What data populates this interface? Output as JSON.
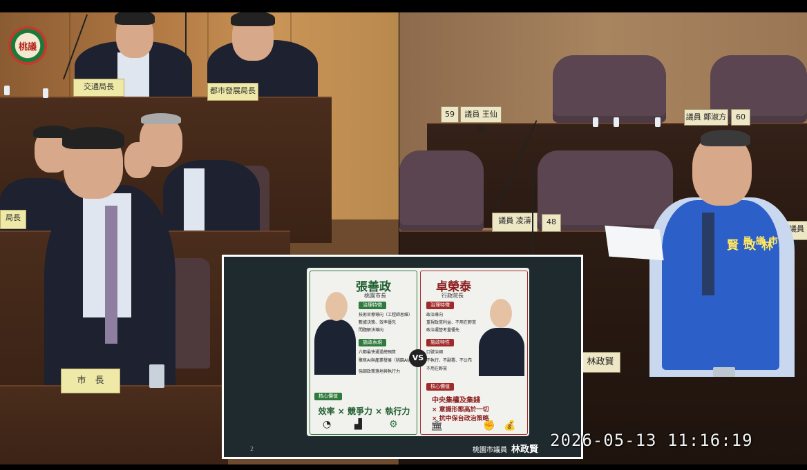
{
  "logo": {
    "text": "桃議"
  },
  "left_feed": {
    "nameplates": {
      "top_left": "交通局長",
      "top_right": "都市發展局長",
      "side": "局長",
      "mayor": "市　長"
    }
  },
  "right_feed": {
    "nameplates": {
      "seat_59_no": "59",
      "seat_59_name": "議員 王仙蓮",
      "seat_60_name": "議員 鄭淑方",
      "seat_60_no": "60",
      "seat_48_name": "議員 凌濤",
      "seat_48_no": "48",
      "speaker_plate": "林政賢",
      "edge_plate": "議員 錢"
    },
    "vest_title": "市議員",
    "vest_name": "林政賢"
  },
  "slide": {
    "left": {
      "name": "張善政",
      "title": "桃園市長",
      "tag1": "治理特徵",
      "items1": [
        "技術官僚導向（工程師思維）",
        "數據決策、效率優先",
        "問題解決導向"
      ],
      "tag2": "施政表現",
      "items2": [
        "六都最快通過總預算",
        "聚焦AI與產業發展（桃園AI產業園）",
        "強調政策落地與執行力"
      ],
      "tag3": "核心價值",
      "values": "效率 × 競爭力 × 執行力"
    },
    "vs": "VS",
    "right": {
      "name": "卓榮泰",
      "title": "行政院長",
      "tag1": "治理特徵",
      "items1": [
        "政治導向",
        "重視政黨利益、不用在野黨",
        "政治運營考量優先"
      ],
      "tag2": "施政特性",
      "items2": [
        "口號治國",
        "不執行、不副署、不公布",
        "不用在野黨"
      ],
      "tag3": "核心價值",
      "values_title": "中央集權及集錢",
      "values_items": [
        "× 意識形態高於一切",
        "× 抗中保台政治策略"
      ]
    },
    "page_number": "2",
    "footer_org": "桃園市議員",
    "footer_name": "林政賢"
  },
  "timestamp": "2026-05-13 11:16:19"
}
